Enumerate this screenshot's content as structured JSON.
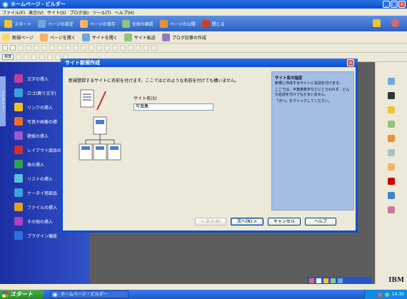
{
  "window": {
    "title": "ホームページ・ビルダー"
  },
  "menu": [
    "ファイル(F)",
    "表示(V)",
    "サイト(S)",
    "ブログ(B)",
    "ツール(T)",
    "ヘルプ(H)"
  ],
  "main_toolbar": [
    {
      "label": "スタート",
      "icon": "start-icon",
      "color": "#f4c430"
    },
    {
      "label": "ページの設定",
      "icon": "page-settings-icon",
      "color": "#6fa8dc"
    },
    {
      "label": "ページの保存",
      "icon": "save-page-icon",
      "color": "#f6b26b"
    },
    {
      "label": "全体の確認",
      "icon": "preview-icon",
      "color": "#93c47d"
    },
    {
      "label": "ページの公開",
      "icon": "publish-icon",
      "color": "#e69138"
    },
    {
      "label": "閉じる",
      "icon": "close-doc-icon",
      "color": "#cc4125"
    }
  ],
  "sub_toolbar": [
    {
      "label": "新規ページ",
      "icon": "new-page-icon"
    },
    {
      "label": "ページを開く",
      "icon": "open-page-icon"
    },
    {
      "label": "サイトを開く",
      "icon": "open-site-icon"
    },
    {
      "label": "サイト転送",
      "icon": "site-transfer-icon"
    },
    {
      "label": "ブログ記事の作成",
      "icon": "blog-post-icon"
    }
  ],
  "format": {
    "style_select": "標準"
  },
  "task_pane": {
    "tab_label": "ナビメニュー",
    "items": [
      {
        "label": "文字の挿入",
        "icon": "text-insert-icon",
        "color": "#c0409a"
      },
      {
        "label": "ロゴ(飾り文字)",
        "icon": "logo-text-icon",
        "color": "#3aa0d8"
      },
      {
        "label": "リンクの挿入",
        "icon": "link-insert-icon",
        "color": "#f0c020"
      },
      {
        "label": "写真や画像の挿",
        "icon": "image-insert-icon",
        "color": "#e76f2e"
      },
      {
        "label": "壁紙の挿入",
        "icon": "wallpaper-icon",
        "color": "#9b59d0"
      },
      {
        "label": "レイアウト部品の",
        "icon": "layout-parts-icon",
        "color": "#d03030"
      },
      {
        "label": "表の挿入",
        "icon": "table-insert-icon",
        "color": "#30a050"
      },
      {
        "label": "リストの挿入",
        "icon": "list-insert-icon",
        "color": "#5bc0de"
      },
      {
        "label": "ケータイ用部品",
        "icon": "mobile-parts-icon",
        "color": "#40a0e0"
      },
      {
        "label": "ファイルの挿入",
        "icon": "file-insert-icon",
        "color": "#e0a020"
      },
      {
        "label": "その他の挿入",
        "icon": "other-insert-icon",
        "color": "#b040c0"
      },
      {
        "label": "プラグイン機能",
        "icon": "plugin-icon",
        "color": "#3070e0"
      }
    ]
  },
  "dialog": {
    "title": "サイト新規作成",
    "instruction": "新規登録するサイトに名前を付けます。ここではどのような名前を付けても構いません。",
    "field_label": "サイト名(S)",
    "field_value": "写真集",
    "help": {
      "heading": "サイト名の指定",
      "p1": "新規に作成するサイトに名前を付けます。",
      "p2": "ここでは、半角英数字などにとらわれず、どんな名前を付けてもかまいません。",
      "p3": "「次へ」をクリックしてください。"
    },
    "buttons": {
      "back": "< 戻る(B)",
      "next": "次へ(N) >",
      "cancel": "キャンセル",
      "help": "ヘルプ"
    }
  },
  "taskbar": {
    "start": "スタート",
    "task": "ホームページ・ビルダー",
    "clock": "14:30"
  },
  "brand_logo": "IBM"
}
